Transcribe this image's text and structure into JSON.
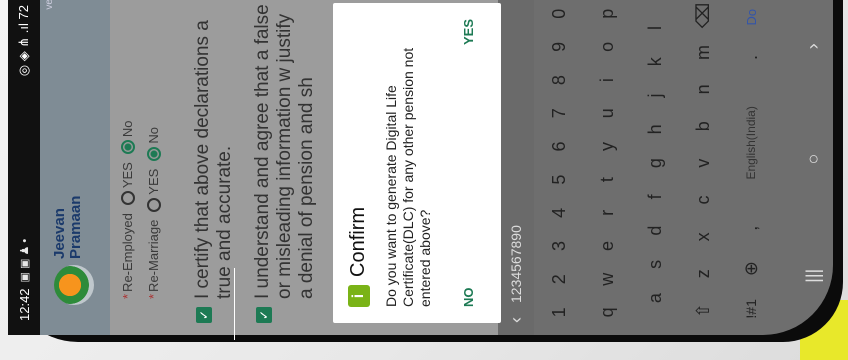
{
  "status_bar": {
    "time": "12:42",
    "left_icons": "▣ ▣ ♟ •",
    "right_icons": "◎ ◈ ⋔ .ıl 72"
  },
  "app": {
    "brand_line1": "Jeevan",
    "brand_line2": "Pramaan",
    "version": "ve",
    "reemployed_label": "Re-Employed",
    "remarriage_label": "Re-Marriage",
    "yes": "YES",
    "no": "No",
    "certify_text": "I certify that above declarations a true and accurate.",
    "understand_text": "I understand and agree that a false or misleading information w justify a denial of pension and sh"
  },
  "dialog": {
    "title": "Confirm",
    "message": "Do you want to generate Digital Life Certificate(DLC) for any other pension not entered above?",
    "no_label": "NO",
    "yes_label": "YES"
  },
  "keyboard": {
    "number_suggestion": "1234567890",
    "row1": [
      "1",
      "2",
      "3",
      "4",
      "5",
      "6",
      "7",
      "8",
      "9",
      "0"
    ],
    "row2": [
      "q",
      "w",
      "e",
      "r",
      "t",
      "y",
      "u",
      "i",
      "o",
      "p"
    ],
    "row3": [
      "a",
      "s",
      "d",
      "f",
      "g",
      "h",
      "j",
      "k",
      "l"
    ],
    "row4": [
      "⇧",
      "z",
      "x",
      "c",
      "v",
      "b",
      "n",
      "m",
      "⌫"
    ],
    "row5": [
      "!#1",
      "⊕",
      ",",
      "English(India)",
      ".",
      "Do"
    ],
    "back_chevron": "‹"
  },
  "nav": {
    "recent": "|||",
    "home": "○",
    "back": "›"
  }
}
